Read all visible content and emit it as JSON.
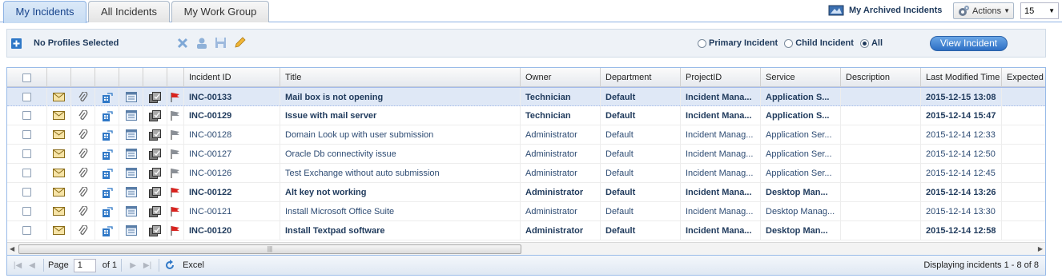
{
  "tabs": [
    {
      "label": "My Incidents",
      "active": true
    },
    {
      "label": "All Incidents",
      "active": false
    },
    {
      "label": "My Work Group",
      "active": false
    }
  ],
  "header": {
    "archived_label": "My Archived Incidents",
    "actions_label": "Actions",
    "page_size": "15"
  },
  "toolbar": {
    "profiles_label": "No Profiles Selected",
    "radio_primary": "Primary Incident",
    "radio_child": "Child Incident",
    "radio_all": "All",
    "view_button": "View Incident"
  },
  "grid": {
    "columns": [
      "Incident ID",
      "Title",
      "Owner",
      "Department",
      "ProjectID",
      "Service",
      "Description",
      "Last Modified Time",
      "Expected"
    ],
    "rows": [
      {
        "id": "INC-00133",
        "title": "Mail box is not opening",
        "owner": "Technician",
        "dept": "Default",
        "project": "Incident Mana...",
        "service": "Application S...",
        "desc": "",
        "modified": "2015-12-15 13:08",
        "bold": true,
        "flag": "red",
        "selected": true
      },
      {
        "id": "INC-00129",
        "title": "Issue with mail server",
        "owner": "Technician",
        "dept": "Default",
        "project": "Incident Mana...",
        "service": "Application S...",
        "desc": "",
        "modified": "2015-12-14 15:47",
        "bold": true,
        "flag": "gray",
        "selected": false
      },
      {
        "id": "INC-00128",
        "title": "Domain Look up with user submission",
        "owner": "Administrator",
        "dept": "Default",
        "project": "Incident Manag...",
        "service": "Application Ser...",
        "desc": "",
        "modified": "2015-12-14 12:33",
        "bold": false,
        "flag": "gray",
        "selected": false
      },
      {
        "id": "INC-00127",
        "title": "Oracle Db connectivity issue",
        "owner": "Administrator",
        "dept": "Default",
        "project": "Incident Manag...",
        "service": "Application Ser...",
        "desc": "",
        "modified": "2015-12-14 12:50",
        "bold": false,
        "flag": "gray",
        "selected": false
      },
      {
        "id": "INC-00126",
        "title": "Test Exchange without auto submission",
        "owner": "Administrator",
        "dept": "Default",
        "project": "Incident Manag...",
        "service": "Application Ser...",
        "desc": "",
        "modified": "2015-12-14 12:45",
        "bold": false,
        "flag": "gray",
        "selected": false
      },
      {
        "id": "INC-00122",
        "title": "Alt key not working",
        "owner": "Administrator",
        "dept": "Default",
        "project": "Incident Mana...",
        "service": "Desktop Man...",
        "desc": "",
        "modified": "2015-12-14 13:26",
        "bold": true,
        "flag": "red",
        "selected": false
      },
      {
        "id": "INC-00121",
        "title": "Install Microsoft Office Suite",
        "owner": "Administrator",
        "dept": "Default",
        "project": "Incident Manag...",
        "service": "Desktop Manag...",
        "desc": "",
        "modified": "2015-12-14 13:30",
        "bold": false,
        "flag": "red",
        "selected": false
      },
      {
        "id": "INC-00120",
        "title": "Install Textpad software",
        "owner": "Administrator",
        "dept": "Default",
        "project": "Incident Mana...",
        "service": "Desktop Man...",
        "desc": "",
        "modified": "2015-12-14 12:58",
        "bold": true,
        "flag": "red",
        "selected": false
      }
    ]
  },
  "paging": {
    "page_label": "Page",
    "page_value": "1",
    "of_label": "of 1",
    "excel_label": "Excel",
    "status": "Displaying incidents 1 - 8 of 8"
  },
  "colors": {
    "accent": "#2d6fc4",
    "flag_red": "#d9231f",
    "flag_gray": "#8a8f96"
  }
}
